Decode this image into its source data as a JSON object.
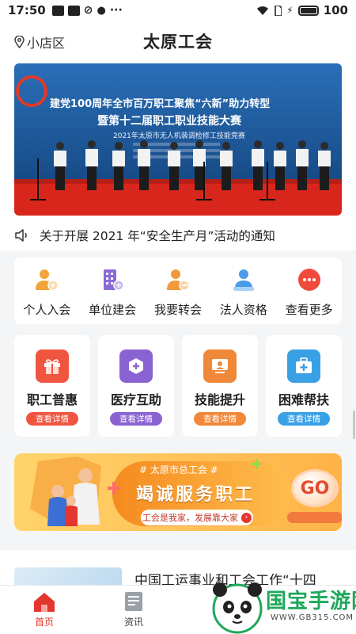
{
  "status_bar": {
    "time": "17:50",
    "battery": "100"
  },
  "header": {
    "location": "小店区",
    "title": "太原工会"
  },
  "banner": {
    "line1": "建党100周年全市百万职工聚焦“六新”助力转型",
    "line2": "暨第十二届职工职业技能大赛",
    "line3": "2021年太原市无人机装调检修工技能竞赛",
    "colors": {
      "sky": "#1e5fa8",
      "carpet": "#d9261c"
    }
  },
  "notice": {
    "text": "关于开展 2021 年“安全生产月”活动的通知"
  },
  "quick_menu": [
    {
      "label": "个人入会",
      "icon": "person-add-icon"
    },
    {
      "label": "单位建会",
      "icon": "building-add-icon"
    },
    {
      "label": "我要转会",
      "icon": "person-transfer-icon"
    },
    {
      "label": "法人资格",
      "icon": "legal-person-icon"
    },
    {
      "label": "查看更多",
      "icon": "more-icon"
    }
  ],
  "services": [
    {
      "title": "职工普惠",
      "button": "查看详情",
      "icon": "gift-icon",
      "color": "#f0553f"
    },
    {
      "title": "医疗互助",
      "button": "查看详情",
      "icon": "medical-help-icon",
      "color": "#8a63d2"
    },
    {
      "title": "技能提升",
      "button": "查看详情",
      "icon": "skill-board-icon",
      "color": "#f0883a"
    },
    {
      "title": "困难帮扶",
      "button": "查看详情",
      "icon": "aid-kit-icon",
      "color": "#3aa0e6"
    }
  ],
  "promo": {
    "subtitle": "# 太原市总工会 #",
    "headline": "竭诚服务职工",
    "pill": "工会是我家，发展靠大家",
    "go": "GO"
  },
  "news": {
    "title": "中国工运事业和工会工作“十四"
  },
  "bottom_nav": [
    {
      "label": "首页",
      "icon": "home-icon",
      "active": true
    },
    {
      "label": "资讯",
      "icon": "news-icon",
      "active": false
    }
  ],
  "watermark": {
    "text": "国宝手游网",
    "url": "WWW.GB315.COM"
  }
}
